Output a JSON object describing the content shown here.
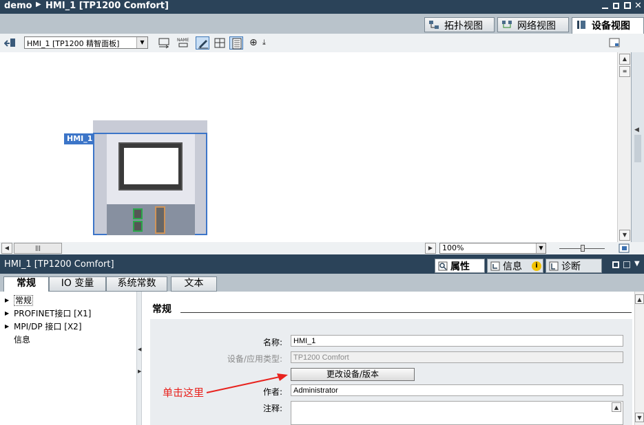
{
  "title_bar": {
    "project": "demo",
    "device": "HMI_1 [TP1200 Comfort]"
  },
  "view_tabs": [
    {
      "label": "拓扑视图",
      "icon": "topology-icon"
    },
    {
      "label": "网络视图",
      "icon": "network-icon"
    },
    {
      "label": "设备视图",
      "icon": "device-icon",
      "active": true
    }
  ],
  "toolbar": {
    "device_select": "HMI_1 [TP1200 精智面板]"
  },
  "canvas": {
    "device_label": "HMI_1"
  },
  "zoom": {
    "value": "100%"
  },
  "properties_header": {
    "title": "HMI_1 [TP1200 Comfort]",
    "tabs": [
      {
        "label": "属性",
        "icon": "properties-icon",
        "active": true
      },
      {
        "label": "信息",
        "icon": "info-icon"
      },
      {
        "label": "诊断",
        "icon": "diagnostics-icon"
      }
    ]
  },
  "sub_tabs": [
    {
      "label": "常规",
      "active": true
    },
    {
      "label": "IO 变量"
    },
    {
      "label": "系统常数"
    },
    {
      "label": "文本"
    }
  ],
  "nav_items": [
    {
      "label": "常规",
      "expandable": true,
      "selected": true
    },
    {
      "label": "PROFINET接口 [X1]",
      "expandable": true
    },
    {
      "label": "MPI/DP 接口 [X2]",
      "expandable": true
    },
    {
      "label": "信息",
      "expandable": false
    }
  ],
  "general": {
    "section_title": "常规",
    "name_label": "名称:",
    "name_value": "HMI_1",
    "type_label": "设备/应用类型:",
    "type_value": "TP1200 Comfort",
    "change_button": "更改设备/版本",
    "author_label": "作者:",
    "author_value": "Administrator",
    "comment_label": "注释:",
    "comment_value": ""
  },
  "annotation": {
    "text": "单击这里",
    "color": "#e8231e"
  },
  "colors": {
    "titlebar": "#2b4359",
    "selection": "#3c75c8"
  }
}
